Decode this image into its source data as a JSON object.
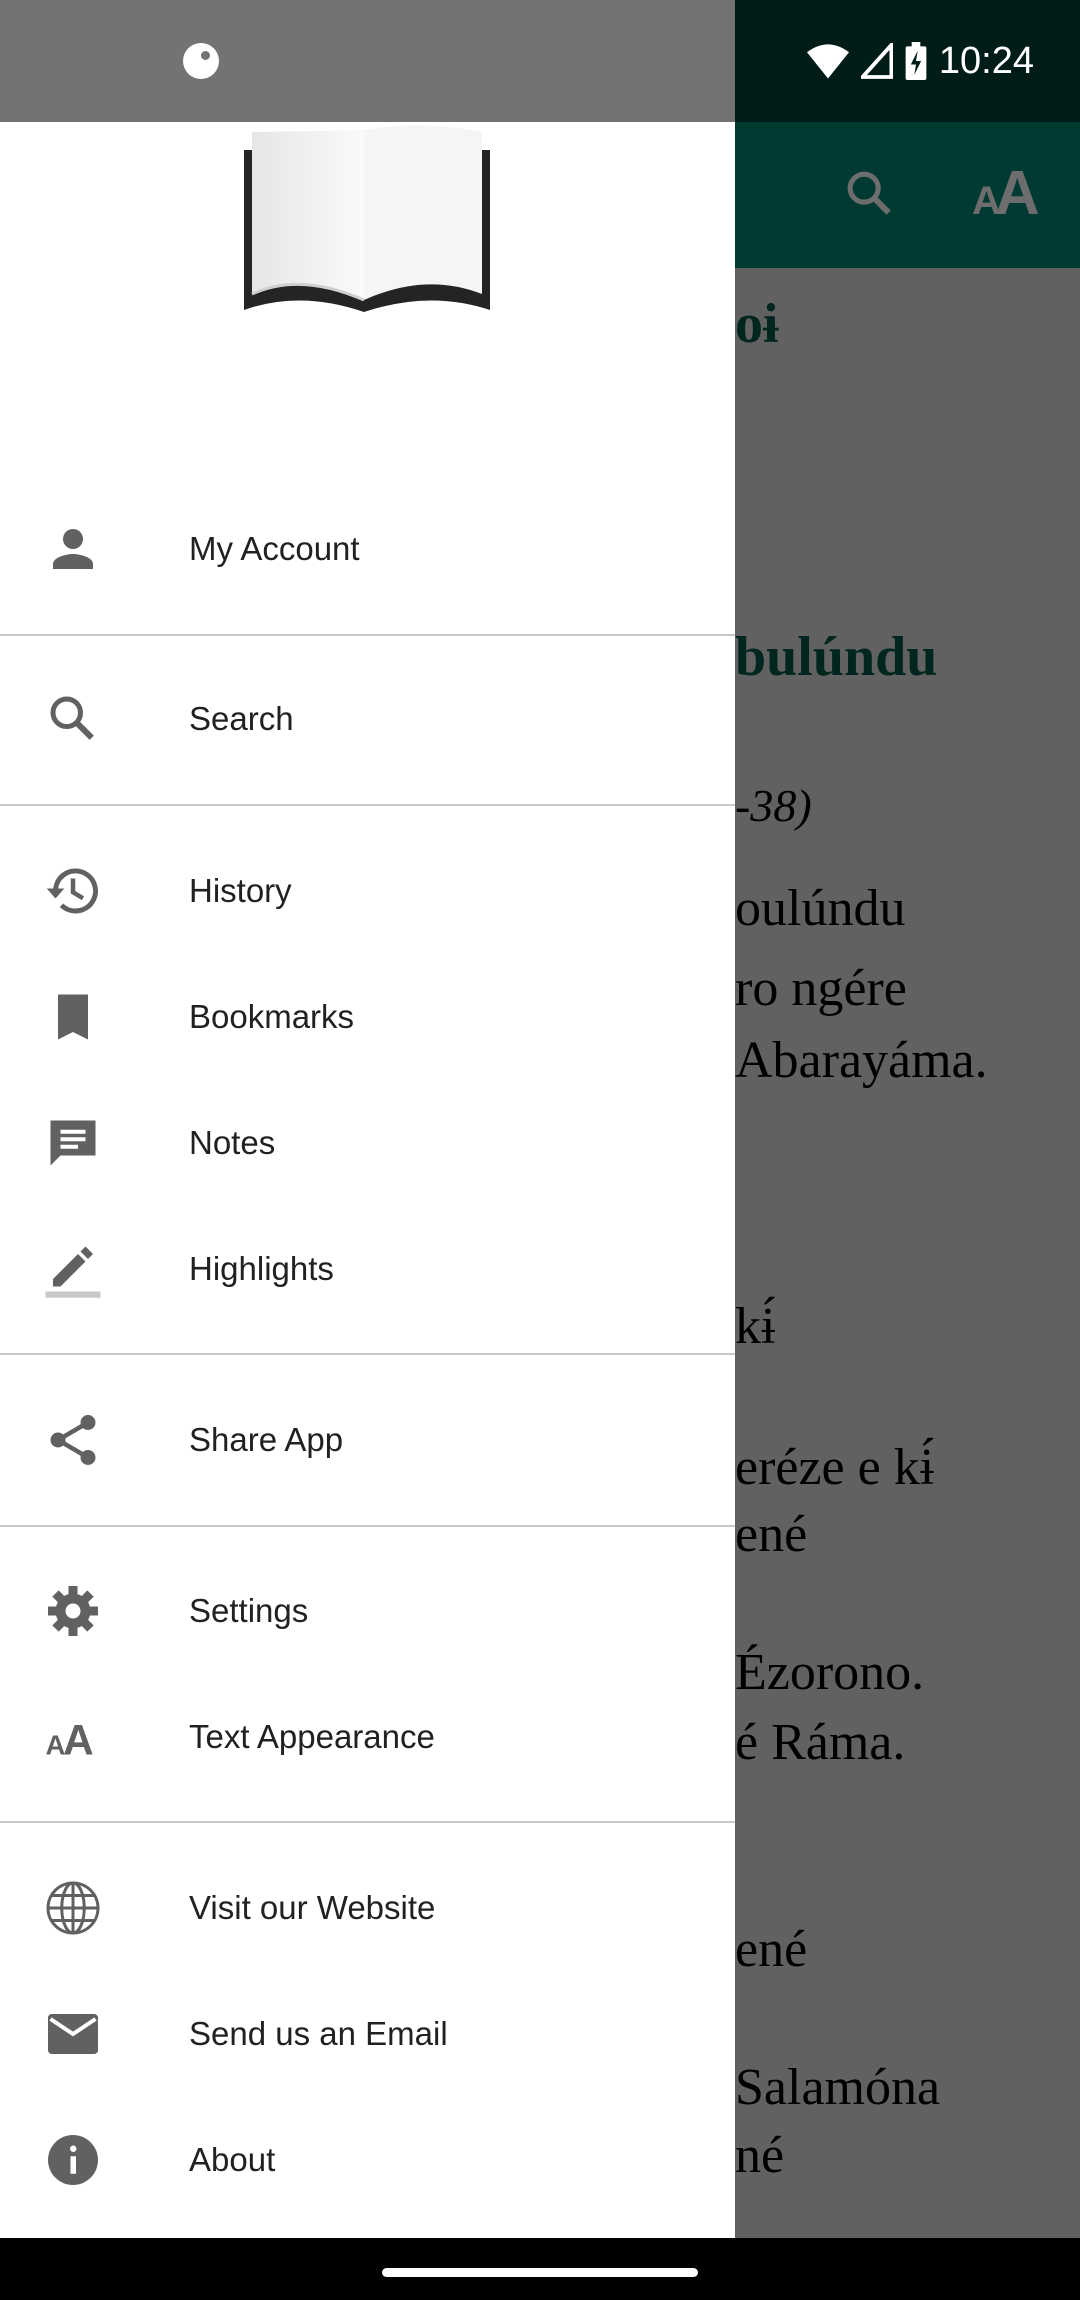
{
  "status_bar": {
    "time": "10:24",
    "icons": [
      "app-notification-icon",
      "wifi-icon",
      "signal-icon",
      "battery-charging-icon"
    ]
  },
  "toolbar": {
    "icons": [
      "search-icon",
      "text-appearance-icon"
    ]
  },
  "reader": {
    "lines": [
      {
        "text": "oɨ",
        "style": "heading"
      },
      {
        "text": "bulúndu",
        "style": "heading"
      },
      {
        "text": "-38)",
        "style": "italic"
      },
      {
        "text": "oulúndu",
        "style": "body"
      },
      {
        "text": " ro ngére",
        "style": "body"
      },
      {
        "text": "Abarayáma.",
        "style": "body"
      },
      {
        "text": " kɨ́",
        "style": "body"
      },
      {
        "text": "eréze e kɨ́",
        "style": "body"
      },
      {
        "text": "ené",
        "style": "body"
      },
      {
        "text": "Ézorono.",
        "style": "body"
      },
      {
        "text": "é Ráma.",
        "style": "body"
      },
      {
        "text": " ené",
        "style": "body"
      },
      {
        "text": " Salamóna",
        "style": "body"
      },
      {
        "text": "né",
        "style": "body"
      }
    ]
  },
  "drawer": {
    "items": [
      {
        "label": "My Account",
        "icon": "person-icon"
      },
      {
        "label": "Search",
        "icon": "search-icon"
      },
      {
        "label": "History",
        "icon": "history-icon"
      },
      {
        "label": "Bookmarks",
        "icon": "bookmark-icon"
      },
      {
        "label": "Notes",
        "icon": "notes-icon"
      },
      {
        "label": "Highlights",
        "icon": "highlight-pen-icon"
      },
      {
        "label": "Share App",
        "icon": "share-icon"
      },
      {
        "label": "Settings",
        "icon": "gear-icon"
      },
      {
        "label": "Text Appearance",
        "icon": "text-appearance-icon"
      },
      {
        "label": "Visit our Website",
        "icon": "globe-icon"
      },
      {
        "label": "Send us an Email",
        "icon": "email-icon"
      },
      {
        "label": "About",
        "icon": "info-icon"
      }
    ]
  },
  "colors": {
    "toolbar": "#003a33",
    "status_bar": "#001c18",
    "scrim": "#616161",
    "heading_text": "#00261f",
    "icon": "#616161"
  }
}
